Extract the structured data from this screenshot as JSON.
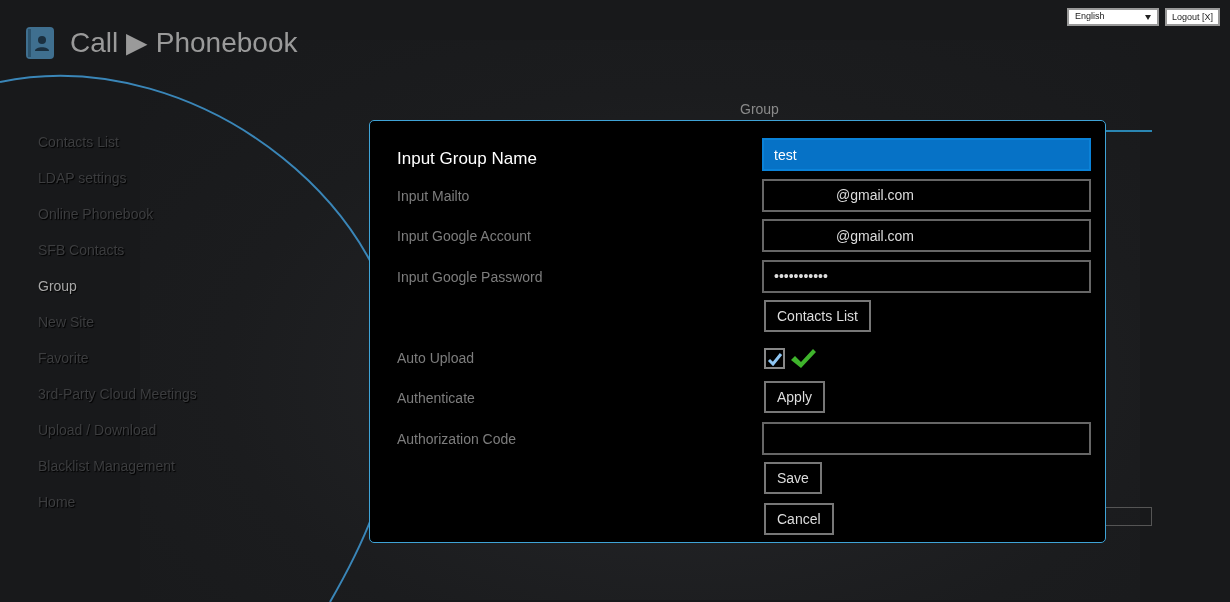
{
  "header": {
    "title": "Call ▶ Phonebook"
  },
  "language": {
    "value": "English"
  },
  "logout": {
    "label": "Logout [X]"
  },
  "sidebar": {
    "items": [
      {
        "label": "Contacts List",
        "selected": false
      },
      {
        "label": "LDAP settings",
        "selected": false
      },
      {
        "label": "Online Phonebook",
        "selected": false
      },
      {
        "label": "SFB Contacts",
        "selected": false
      },
      {
        "label": "Group",
        "selected": true
      },
      {
        "label": "New Site",
        "selected": false
      },
      {
        "label": "Favorite",
        "selected": false
      },
      {
        "label": "3rd-Party Cloud Meetings",
        "selected": false
      },
      {
        "label": "Upload / Download",
        "selected": false
      },
      {
        "label": "Blacklist Management",
        "selected": false
      },
      {
        "label": "Home",
        "selected": false
      }
    ]
  },
  "page": {
    "heading": "Group"
  },
  "dialog": {
    "rows": [
      {
        "kind": "input",
        "label": "Input Group Name",
        "value": "test",
        "focused": true
      },
      {
        "kind": "input",
        "label": "Input Mailto",
        "value": "@gmail.com",
        "focused": false
      },
      {
        "kind": "input",
        "label": "Input Google Account",
        "value": "@gmail.com",
        "focused": false
      },
      {
        "kind": "input",
        "label": "Input Google Password",
        "value": "•••••••••••",
        "focused": false
      },
      {
        "kind": "button",
        "button": "Contacts List"
      },
      {
        "kind": "checkbox",
        "label": "Auto Upload",
        "checked": true
      },
      {
        "kind": "button",
        "label": "Authenticate",
        "button": "Apply"
      },
      {
        "kind": "input",
        "label": "Authorization Code",
        "focused": false
      },
      {
        "kind": "button",
        "button": "Save"
      },
      {
        "kind": "button",
        "button": "Cancel"
      }
    ]
  }
}
